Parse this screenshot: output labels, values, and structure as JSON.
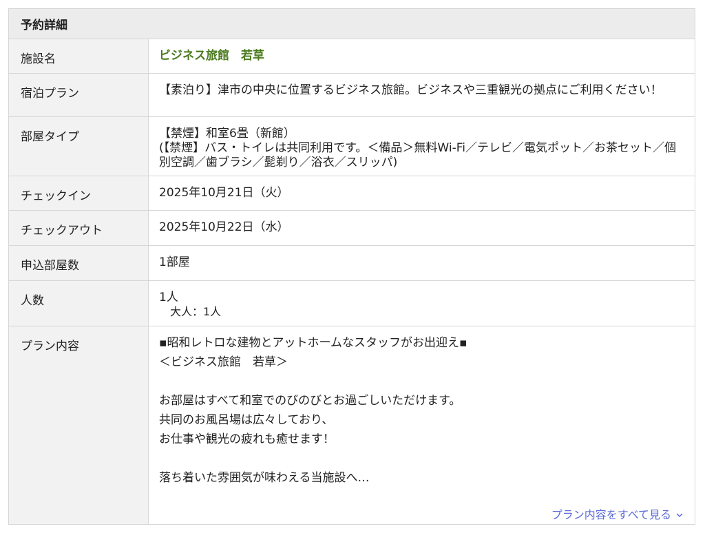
{
  "panel": {
    "title": "予約詳細"
  },
  "rows": {
    "facility": {
      "label": "施設名",
      "value": "ビジネス旅館　若草"
    },
    "plan": {
      "label": "宿泊プラン",
      "value": "【素泊り】津市の中央に位置するビジネス旅館。ビジネスや三重観光の拠点にご利用ください！"
    },
    "room": {
      "label": "部屋タイプ",
      "line1": "【禁煙】和室6畳（新館）",
      "line2": "(【禁煙】バス・トイレは共同利用です。＜備品＞無料Wi-Fi／テレビ／電気ポット／お茶セット／個別空調／歯ブラシ／髭剃り／浴衣／スリッパ)"
    },
    "checkin": {
      "label": "チェックイン",
      "value": "2025年10月21日（火）"
    },
    "checkout": {
      "label": "チェックアウト",
      "value": "2025年10月22日（水）"
    },
    "rooms": {
      "label": "申込部屋数",
      "value": "1部屋"
    },
    "people": {
      "label": "人数",
      "value": "1人",
      "detail": "大人：1人"
    },
    "content": {
      "label": "プラン内容",
      "line1": "▪昭和レトロな建物とアットホームなスタッフがお出迎え▪",
      "line2": "＜ビジネス旅館　若草＞",
      "line3": "お部屋はすべて和室でのびのびとお過ごしいただけます。",
      "line4": "共同のお風呂場は広々しており、",
      "line5": "お仕事や観光の疲れも癒せます！",
      "line6": "落ち着いた雰囲気が味わえる当施設へ…",
      "more_link": "プラン内容をすべて見る"
    }
  },
  "colors": {
    "facility_name": "#4a7a1e",
    "link": "#5b6bd8",
    "header_bg": "#ececec",
    "label_bg": "#f2f2f2"
  }
}
